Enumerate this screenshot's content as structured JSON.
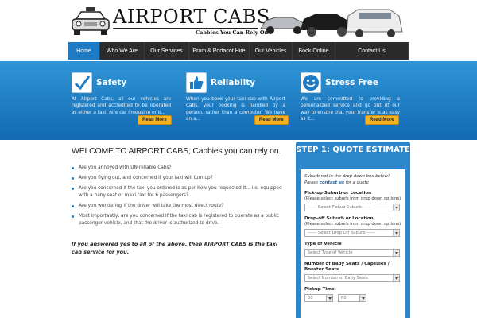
{
  "header": {
    "brand": "AIRPORT CABS",
    "tagline": "Cabbies You Can Rely On"
  },
  "nav": {
    "items": [
      {
        "label": "Home",
        "active": true
      },
      {
        "label": "Who We Are",
        "active": false
      },
      {
        "label": "Our Services",
        "active": false
      },
      {
        "label": "Pram & Portacot Hire",
        "active": false
      },
      {
        "label": "Our Vehicles",
        "active": false
      },
      {
        "label": "Book Online",
        "active": false
      },
      {
        "label": "Contact Us",
        "active": false
      }
    ]
  },
  "features": [
    {
      "icon": "checkmark-icon",
      "title": "Safety",
      "text": "At Airport Cabs, all our vehicles are registered and accredited to be operated as either a taxi, hire car limousine or b...",
      "button": "Read More"
    },
    {
      "icon": "thumbs-up-icon",
      "title": "Reliabilty",
      "text": "When you book your taxi cab with Airport Cabs, your booking is handled by a person, rather than a computer. We have an a...",
      "button": "Read More"
    },
    {
      "icon": "smiley-icon",
      "title": "Stress Free",
      "text": "We are committed to providing a personalized service and go out of our way to ensure that your transfer is as easy as it...",
      "button": "Read More"
    }
  ],
  "main": {
    "heading": "WELCOME TO AIRPORT CABS, Cabbies you can rely on.",
    "bullets": [
      "Are you annoyed with UN-reliable Cabs?",
      "Are you flying out, and concerned if your taxi will turn up?",
      "Are you concerned if the taxi you ordered is as per how you requested it... i.e. equipped with a baby seat or maxi taxi for 6 passengers?",
      "Are you wondering if the driver will take the most direct route?",
      "Most importantly, are you concerned if the taxi cab is registered to operate as a public passenger vehicle, and that the driver is authorized to drive."
    ],
    "closing": "If you answered yes to all of the above, then AIRPORT CABS is the taxi cab service for you."
  },
  "quote": {
    "title": "STEP 1: QUOTE ESTIMATE",
    "note_before": "Suburb not in the drop down box below? Please",
    "note_link": "contact us",
    "note_after": "for a quote",
    "pickup_label": "Pick-up Suburb or Location",
    "pickup_sub": "(Please select suburb from drop down options)",
    "pickup_placeholder": "------ Select Pickup Suburb ------",
    "dropoff_label": "Drop-off Suburb or Location",
    "dropoff_sub": "(Please select suburb from drop down options)",
    "dropoff_placeholder": "------ Select Drop Off Suburb ------",
    "vehicle_label": "Type of Vehicle",
    "vehicle_placeholder": "Select Type of Vehicle",
    "seats_label": "Number of Baby Seats / Capsules / Booster Seats",
    "seats_placeholder": "Select Number of Baby Seats",
    "time_label": "Pickup Time",
    "hour_value": "00",
    "minute_value": "00"
  },
  "colors": {
    "accent": "#1f7cc4",
    "button": "#f5b324",
    "nav_bg": "#2b2b2b"
  }
}
